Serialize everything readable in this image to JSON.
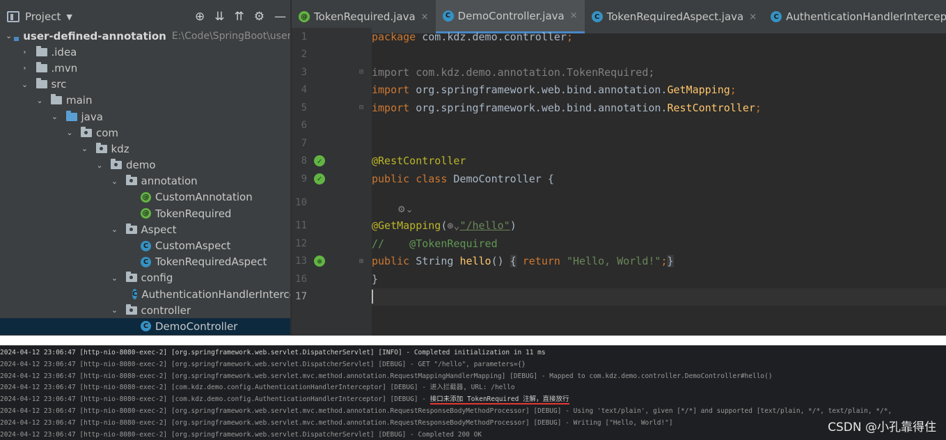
{
  "project_panel": {
    "title": "Project",
    "tree": [
      {
        "label": "user-defined-annotation",
        "path": "E:\\Code\\SpringBoot\\user-d",
        "depth": 0,
        "kind": "module",
        "expanded": true
      },
      {
        "label": ".idea",
        "depth": 1,
        "kind": "folder",
        "expanded": false
      },
      {
        "label": ".mvn",
        "depth": 1,
        "kind": "folder",
        "expanded": false
      },
      {
        "label": "src",
        "depth": 1,
        "kind": "folder",
        "expanded": true
      },
      {
        "label": "main",
        "depth": 2,
        "kind": "folder",
        "expanded": true
      },
      {
        "label": "java",
        "depth": 3,
        "kind": "source-folder",
        "expanded": true
      },
      {
        "label": "com",
        "depth": 4,
        "kind": "package",
        "expanded": true
      },
      {
        "label": "kdz",
        "depth": 5,
        "kind": "package",
        "expanded": true
      },
      {
        "label": "demo",
        "depth": 6,
        "kind": "package",
        "expanded": true
      },
      {
        "label": "annotation",
        "depth": 7,
        "kind": "package",
        "expanded": true
      },
      {
        "label": "CustomAnnotation",
        "depth": 8,
        "kind": "annotation"
      },
      {
        "label": "TokenRequired",
        "depth": 8,
        "kind": "annotation"
      },
      {
        "label": "Aspect",
        "depth": 7,
        "kind": "package",
        "expanded": true
      },
      {
        "label": "CustomAspect",
        "depth": 8,
        "kind": "class"
      },
      {
        "label": "TokenRequiredAspect",
        "depth": 8,
        "kind": "class"
      },
      {
        "label": "config",
        "depth": 7,
        "kind": "package",
        "expanded": true
      },
      {
        "label": "AuthenticationHandlerIntercep",
        "depth": 8,
        "kind": "class"
      },
      {
        "label": "controller",
        "depth": 7,
        "kind": "package",
        "expanded": true
      },
      {
        "label": "DemoController",
        "depth": 8,
        "kind": "class",
        "selected": true
      }
    ]
  },
  "tabs": [
    {
      "label": "TokenRequired.java",
      "kind": "annotation",
      "active": false
    },
    {
      "label": "DemoController.java",
      "kind": "class",
      "active": true
    },
    {
      "label": "TokenRequiredAspect.java",
      "kind": "class",
      "active": false
    },
    {
      "label": "AuthenticationHandlerInterceptor.java",
      "kind": "class",
      "active": false
    }
  ],
  "editor": {
    "line_numbers": [
      "1",
      "2",
      "3",
      "4",
      "5",
      "6",
      "7",
      "8",
      "9",
      "10",
      "11",
      "12",
      "13",
      "16",
      "17"
    ],
    "code": {
      "l1_kw": "package",
      "l1_rest": " com.kdz.demo.controller",
      "l1_semi": ";",
      "l3_kw": "import",
      "l3_rest": " com.kdz.demo.annotation.TokenRequired;",
      "l4_kw": "import",
      "l4_rest": " org.springframework.web.bind.annotation.",
      "l4_cls": "GetMapping",
      "l4_semi": ";",
      "l5_kw": "import",
      "l5_rest": " org.springframework.web.bind.annotation.",
      "l5_cls": "RestController",
      "l5_semi": ";",
      "l8_ann": "@RestController",
      "l9_kw": "public class",
      "l9_rest": " DemoController {",
      "l11_ann": "@GetMapping",
      "l11_open": "(",
      "l11_url": "\"/hello\"",
      "l11_close": ")",
      "l12_cmt": "//    @TokenRequired",
      "l13_kw": "public",
      "l13_type": " String ",
      "l13_meth": "hello",
      "l13_parens": "() ",
      "l13_brace1": "{",
      "l13_ret": " return ",
      "l13_str": "\"Hello, World!\"",
      "l13_semi": ";",
      "l13_brace2": "}",
      "l16": "}"
    }
  },
  "console": {
    "lines": [
      "2024-04-12 23:06:47 [http-nio-8080-exec-2] [org.springframework.web.servlet.DispatcherServlet] [INFO] - Completed initialization in 11 ms",
      "2024-04-12 23:06:47 [http-nio-8080-exec-2] [org.springframework.web.servlet.DispatcherServlet] [DEBUG] - GET \"/hello\", parameters={}",
      "2024-04-12 23:06:47 [http-nio-8080-exec-2] [org.springframework.web.servlet.mvc.method.annotation.RequestMappingHandlerMapping] [DEBUG] - Mapped to com.kdz.demo.controller.DemoController#hello()",
      "2024-04-12 23:06:47 [http-nio-8080-exec-2] [com.kdz.demo.config.AuthenticationHandlerInterceptor] [DEBUG] - 进入拦截器, URL: /hello",
      "2024-04-12 23:06:47 [http-nio-8080-exec-2] [com.kdz.demo.config.AuthenticationHandlerInterceptor] [DEBUG] - ",
      "2024-04-12 23:06:47 [http-nio-8080-exec-2] [org.springframework.web.servlet.mvc.method.annotation.RequestResponseBodyMethodProcessor] [DEBUG] - Using 'text/plain', given [*/*] and supported [text/plain, */*, text/plain, */*,",
      "2024-04-12 23:06:47 [http-nio-8080-exec-2] [org.springframework.web.servlet.mvc.method.annotation.RequestResponseBodyMethodProcessor] [DEBUG] - Writing [\"Hello, World!\"]",
      "2024-04-12 23:06:47 [http-nio-8080-exec-2] [org.springframework.web.servlet.DispatcherServlet] [DEBUG] - Completed 200 OK"
    ],
    "highlight": "接口未添加 TokenRequired 注解，直接放行"
  },
  "watermark": "CSDN @小孔靠得住",
  "colors": {
    "accent": "#4a88c7",
    "keyword": "#cc7832",
    "annotation": "#bbb529",
    "string": "#6a8759",
    "underline": "#e53935"
  }
}
